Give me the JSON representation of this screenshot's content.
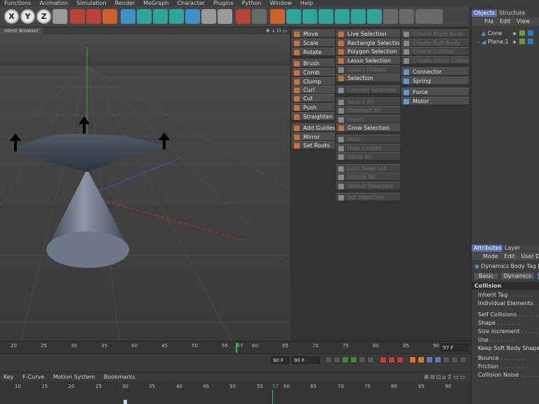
{
  "menu": [
    "Functions",
    "Animation",
    "Simulation",
    "Render",
    "MoGraph",
    "Character",
    "Plugins",
    "Python",
    "Window",
    "Help"
  ],
  "toolbar": {
    "axes": [
      "X",
      "Y",
      "Z"
    ]
  },
  "viewport": {
    "tab_label": "ntent Browser",
    "corner_icons": "✥↓⊡▭"
  },
  "palette": {
    "col1": [
      {
        "label": "Move",
        "enabled": true
      },
      {
        "label": "Scale",
        "enabled": true
      },
      {
        "label": "Rotate",
        "enabled": true
      },
      {
        "label": "Brush",
        "enabled": true
      },
      {
        "label": "Comb",
        "enabled": true
      },
      {
        "label": "Clump",
        "enabled": true
      },
      {
        "label": "Curl",
        "enabled": true
      },
      {
        "label": "Cut",
        "enabled": true
      },
      {
        "label": "Push",
        "enabled": true
      },
      {
        "label": "Straighten",
        "enabled": true
      },
      {
        "label": "Add Guides",
        "enabled": true
      },
      {
        "label": "Mirror",
        "enabled": true
      },
      {
        "label": "Set Roots",
        "enabled": true
      }
    ],
    "col2": [
      {
        "label": "Live Selection",
        "enabled": true
      },
      {
        "label": "Rectangle Selection",
        "enabled": true
      },
      {
        "label": "Polygon Selection",
        "enabled": true
      },
      {
        "label": "Lasso Selection",
        "enabled": true
      },
      {
        "label": "Select Hidden",
        "enabled": false
      },
      {
        "label": "Selection",
        "enabled": true
      },
      {
        "label": "Convert Selected",
        "enabled": false
      },
      {
        "label": "Select All",
        "enabled": false
      },
      {
        "label": "Deselect All",
        "enabled": false
      },
      {
        "label": "Invert",
        "enabled": false
      },
      {
        "label": "Grow Selection",
        "enabled": true
      },
      {
        "label": "Hide",
        "enabled": false
      },
      {
        "label": "Hide Locked",
        "enabled": false
      },
      {
        "label": "Show All",
        "enabled": false
      },
      {
        "label": "Lock Selected",
        "enabled": false
      },
      {
        "label": "Unlock All",
        "enabled": false
      },
      {
        "label": "Unlock Selected",
        "enabled": false
      },
      {
        "label": "Set Selection",
        "enabled": false
      }
    ],
    "col3": [
      {
        "label": "Create Rigid Body",
        "enabled": false
      },
      {
        "label": "Create Soft Body",
        "enabled": false
      },
      {
        "label": "Create Collider",
        "enabled": false
      },
      {
        "label": "Create Ghost Collider",
        "enabled": false
      },
      {
        "label": "Connector",
        "enabled": true
      },
      {
        "label": "Spring",
        "enabled": true
      },
      {
        "label": "Force",
        "enabled": true
      },
      {
        "label": "Motor",
        "enabled": true
      }
    ]
  },
  "objects": {
    "tabs": [
      "Objects",
      "Structure"
    ],
    "menu": [
      "File",
      "Edit",
      "View"
    ],
    "rows": [
      "Cone",
      "Plane.1"
    ]
  },
  "attributes": {
    "tabs": [
      "Attributes",
      "Layer Browser"
    ],
    "menu": [
      "Mode",
      "Edit",
      "User Da"
    ],
    "tag_title": "Dynamics Body Tag [",
    "subtabs": [
      "Basic",
      "Dynamics",
      "Co"
    ],
    "section": "Collision",
    "rows": [
      "Inherit Tag",
      "Individual Elements",
      "Self Collisions",
      "Shape",
      "Size Increment",
      "Use",
      "Keep Soft Body Shape",
      "Bounce",
      "Friction",
      "Collision Noise"
    ]
  },
  "timeline": {
    "ruler_ticks": [
      "20",
      "25",
      "30",
      "35",
      "40",
      "45",
      "50",
      "55",
      "57",
      "60",
      "65",
      "70",
      "75",
      "80",
      "85",
      "90"
    ],
    "current_frame_field": "57 F",
    "end_frame_field": "90 F",
    "min_field": "90 F",
    "menu": [
      "Key",
      "F-Curve",
      "Motion System",
      "Bookmarks"
    ],
    "lower_ticks": [
      "10",
      "15",
      "20",
      "25",
      "30",
      "35",
      "40",
      "45",
      "50",
      "55",
      "57",
      "60",
      "65",
      "70",
      "75",
      "80",
      "85",
      "90"
    ]
  },
  "colors": {
    "background": "#3a3a3a",
    "panel": "#3d3d3d",
    "active_tab": "#5a6fb0",
    "playhead": "#35c26a"
  }
}
